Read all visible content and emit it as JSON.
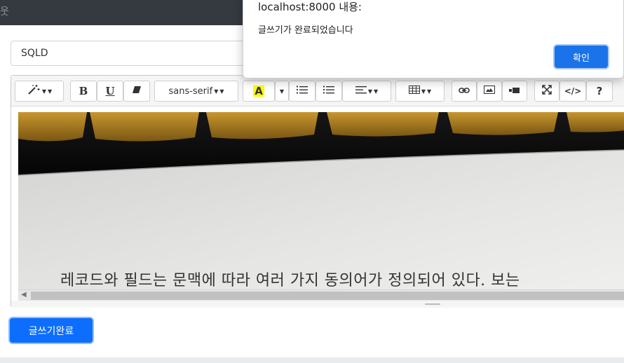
{
  "navbar": {
    "brand_fragment": "웃"
  },
  "title_input": {
    "value": "SQLD"
  },
  "toolbar": {
    "style_icon": "magic-wand-icon",
    "bold_label": "B",
    "underline_label": "U",
    "clear_format_icon": "eraser-icon",
    "font_family_value": "sans-serif",
    "color_label": "A",
    "color_highlight": "#ffff00",
    "unordered_list_icon": "unordered-list-icon",
    "ordered_list_icon": "ordered-list-icon",
    "paragraph_icon": "align-left-icon",
    "table_icon": "table-icon",
    "link_icon": "link-icon",
    "picture_icon": "picture-icon",
    "video_icon": "video-icon",
    "fullscreen_icon": "fullscreen-icon",
    "codeview_label": "</>",
    "help_label": "?"
  },
  "editor_content": {
    "image_text": "레코드와 필드는 문맥에 따라 여러 가지 동의어가 정의되어 있다. 보는"
  },
  "submit_button": {
    "label": "글쓰기완료"
  },
  "alert_dialog": {
    "title": "localhost:8000 내용:",
    "message": "글쓰기가 완료되었습니다",
    "ok_label": "확인"
  },
  "colors": {
    "navbar": "#343a40",
    "primary": "#0d6efd",
    "dialog_button": "#1a73e8"
  }
}
